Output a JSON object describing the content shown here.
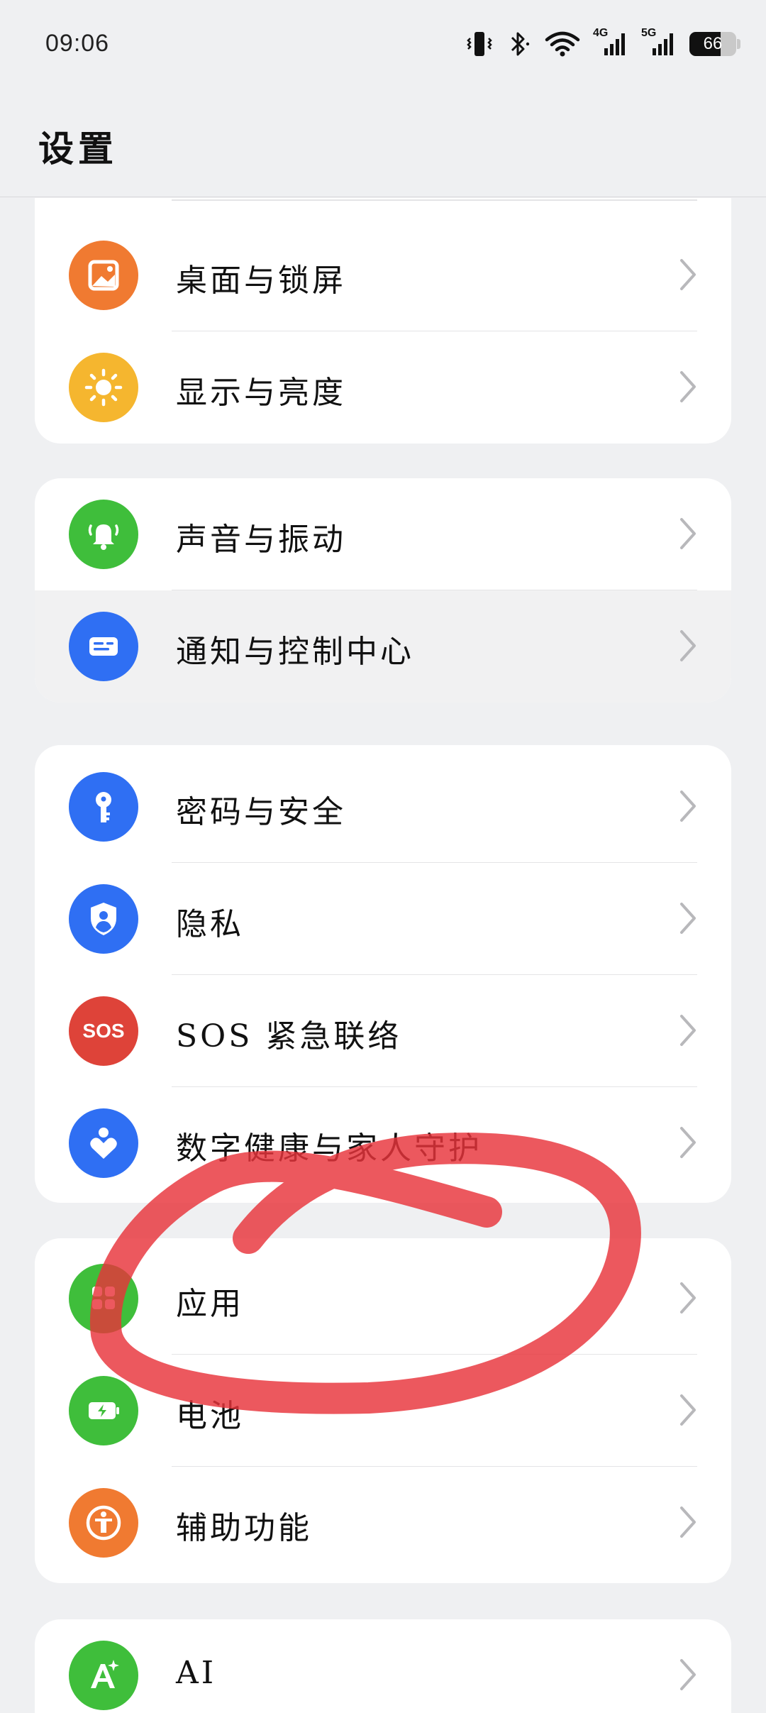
{
  "status_bar": {
    "time": "09:06",
    "icons": [
      "vibrate-icon",
      "bluetooth-icon",
      "wifi-icon",
      "signal-4g-icon",
      "signal-5g-icon"
    ],
    "network_labels": [
      "4G",
      "5G"
    ],
    "battery_percent": "66",
    "battery_level": 0.66
  },
  "header": {
    "title": "设置"
  },
  "groups": [
    {
      "items": [
        {
          "label": "桌面与锁屏",
          "icon": "wallpaper-icon",
          "color": "#f07a31"
        },
        {
          "label": "显示与亮度",
          "icon": "brightness-icon",
          "color": "#f5b62f"
        }
      ]
    },
    {
      "items": [
        {
          "label": "声音与振动",
          "icon": "bell-icon",
          "color": "#3fbe3b"
        },
        {
          "label": "通知与控制中心",
          "icon": "notification-icon",
          "color": "#2f6ff3"
        }
      ]
    },
    {
      "items": [
        {
          "label": "密码与安全",
          "icon": "key-icon",
          "color": "#2f6ff3"
        },
        {
          "label": "隐私",
          "icon": "privacy-shield-icon",
          "color": "#2f6ff3"
        },
        {
          "label": "SOS 紧急联络",
          "icon": "sos-icon",
          "icon_text": "SOS",
          "color": "#de4339"
        },
        {
          "label": "数字健康与家人守护",
          "icon": "wellbeing-icon",
          "color": "#2f6ff3"
        }
      ]
    },
    {
      "items": [
        {
          "label": "应用",
          "icon": "apps-icon",
          "color": "#3fbe3b"
        },
        {
          "label": "电池",
          "icon": "battery-icon",
          "color": "#3fbe3b"
        },
        {
          "label": "辅助功能",
          "icon": "accessibility-icon",
          "color": "#f07a31"
        }
      ]
    },
    {
      "items": [
        {
          "label": "AI",
          "icon": "ai-icon",
          "color": "#3fbe3b"
        }
      ]
    }
  ],
  "colors": {
    "background": "#eff0f2",
    "card": "#ffffff",
    "annotation": "#e8333b"
  }
}
